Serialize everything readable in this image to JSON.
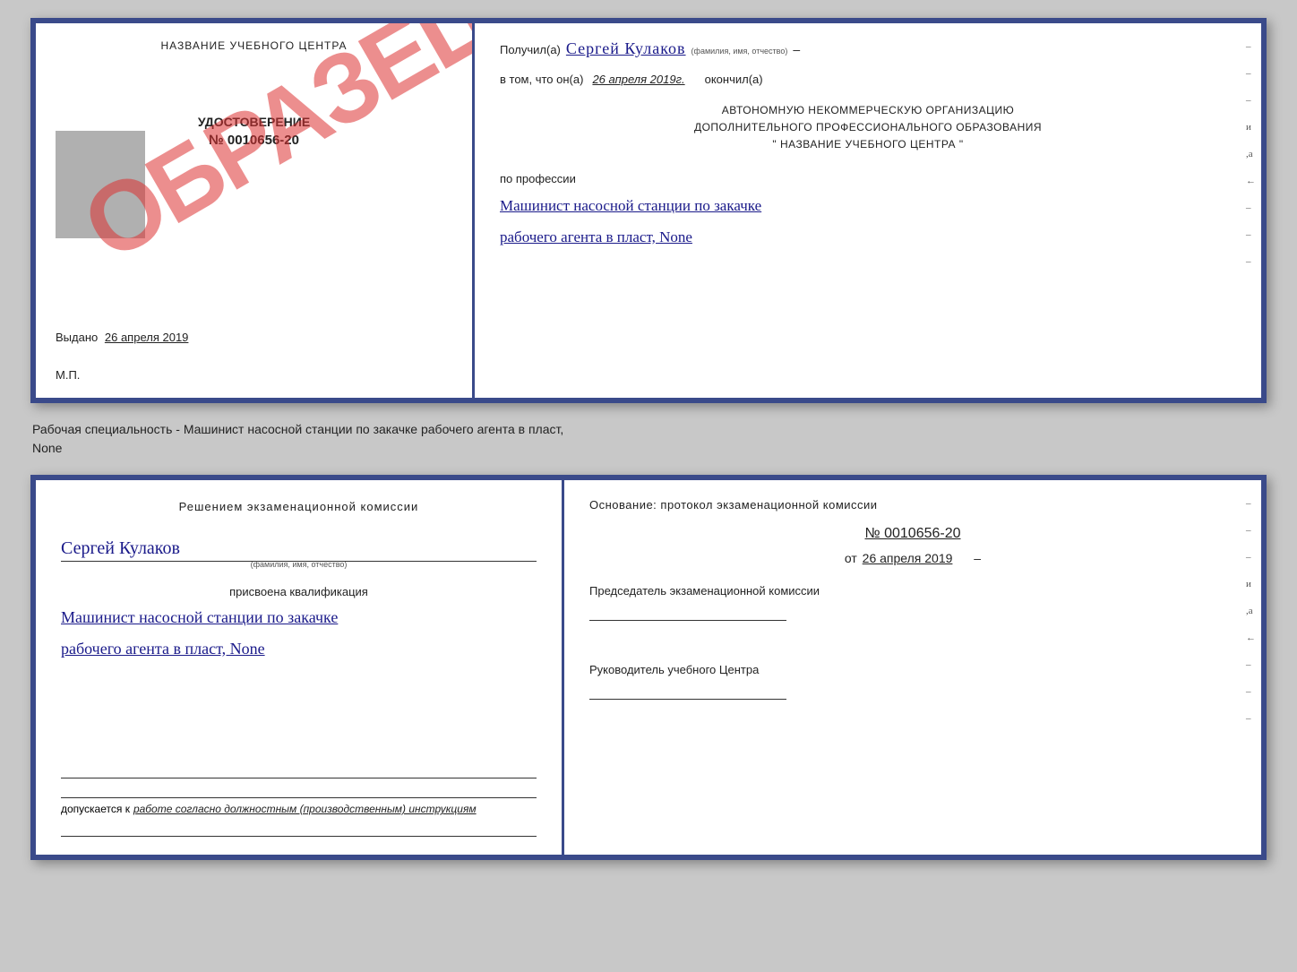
{
  "topDoc": {
    "left": {
      "schoolName": "НАЗВАНИЕ УЧЕБНОГО ЦЕНТРА",
      "watermark": "ОБРАЗЕЦ",
      "certTitle": "УДОСТОВЕРЕНИЕ",
      "certNumber": "№ 0010656-20",
      "issuedLabel": "Выдано",
      "issuedDate": "26 апреля 2019",
      "mpLabel": "М.П."
    },
    "right": {
      "receivedLabel": "Получил(а)",
      "recipientName": "Сергей Кулаков",
      "fioHint": "(фамилия, имя, отчество)",
      "dash1": "–",
      "inThatLabel": "в том, что он(а)",
      "dateValue": "26 апреля 2019г.",
      "finishedLabel": "окончил(а)",
      "orgLine1": "АВТОНОМНУЮ НЕКОММЕРЧЕСКУЮ ОРГАНИЗАЦИЮ",
      "orgLine2": "ДОПОЛНИТЕЛЬНОГО ПРОФЕССИОНАЛЬНОГО ОБРАЗОВАНИЯ",
      "orgLine3": "\"  НАЗВАНИЕ УЧЕБНОГО ЦЕНТРА  \"",
      "professionLabel": "по профессии",
      "professionLine1": "Машинист насосной станции по закачке",
      "professionLine2": "рабочего агента в пласт, None"
    }
  },
  "betweenText": {
    "line1": "Рабочая специальность - Машинист насосной станции по закачке рабочего агента в пласт,",
    "line2": "None"
  },
  "bottomDoc": {
    "left": {
      "decisionTitle": "Решением  экзаменационной  комиссии",
      "personName": "Сергей Кулаков",
      "fioHint": "(фамилия, имя, отчество)",
      "assignedLabel": "присвоена квалификация",
      "qualLine1": "Машинист насосной станции по закачке",
      "qualLine2": "рабочего агента в пласт, None",
      "allowedPrefix": "допускается к",
      "allowedText": "работе согласно должностным (производственным) инструкциям"
    },
    "right": {
      "basisLabel": "Основание: протокол экзаменационной комиссии",
      "protocolNumber": "№  0010656-20",
      "protocolDatePrefix": "от",
      "protocolDate": "26 апреля 2019",
      "chairmanLabel": "Председатель экзаменационной комиссии",
      "directorLabel": "Руководитель учебного Центра"
    }
  },
  "sideMarks": [
    "-",
    "-",
    "-",
    "и",
    "а",
    "←",
    "-",
    "-",
    "-"
  ]
}
